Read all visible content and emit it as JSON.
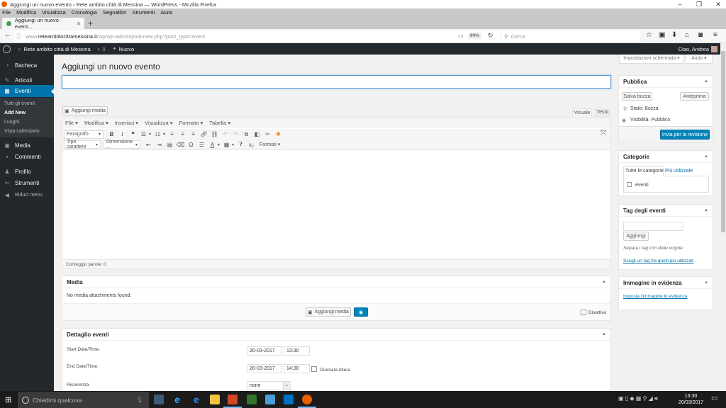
{
  "window": {
    "title": "Aggiungi un nuovo evento ‹ Rete ambito città di Messina — WordPress - Mozilla Firefox",
    "minimize": "–",
    "restore": "❐",
    "close": "✕"
  },
  "menubar": [
    "File",
    "Modifica",
    "Visualizza",
    "Cronologia",
    "Segnalibri",
    "Strumenti",
    "Aiuto"
  ],
  "browser": {
    "tab_title": "Aggiungi un nuovo event...",
    "tab_close": "✕",
    "new_tab": "+",
    "url_domain": "www.reteambitocittamessina.it",
    "url_path": "/wp/wp-admin/post-new.php?post_type=event",
    "url_prefix": "www.",
    "url_host": "reteambitocittamessina.it",
    "zoom_level": "90%",
    "search_placeholder": "Cerca"
  },
  "adminbar": {
    "site_name": "Rete ambito città di Messina",
    "comments_count": "0",
    "new_label": "Nuovo",
    "greeting": "Ciao, Andrea"
  },
  "sidebar": {
    "items": [
      {
        "label": "Bacheca",
        "icon": "dashboard-icon"
      },
      {
        "label": "Articoli",
        "icon": "pin-icon"
      },
      {
        "label": "Eventi",
        "icon": "calendar-icon"
      },
      {
        "label": "Media",
        "icon": "media-icon"
      },
      {
        "label": "Commenti",
        "icon": "comment-icon"
      },
      {
        "label": "Profilo",
        "icon": "user-icon"
      },
      {
        "label": "Strumenti",
        "icon": "wrench-icon"
      },
      {
        "label": "Riduci menu",
        "icon": "collapse-icon"
      }
    ],
    "submenu": [
      "Tutti gli eventi",
      "Add New",
      "Luoghi",
      "Vista calendario"
    ]
  },
  "header": {
    "screen_options": "Impostazioni schermata ▾",
    "help": "Aiuto ▾",
    "page_title": "Aggiungi un nuovo evento",
    "title_value": ""
  },
  "editor": {
    "add_media": "Aggiungi media",
    "tab_visual": "Visuale",
    "tab_text": "Testo",
    "menus": [
      "File ▾",
      "Modifica ▾",
      "Inserisci ▾",
      "Visualizza ▾",
      "Formato ▾",
      "Tabella ▾"
    ],
    "paragraph_select": "Paragrafo",
    "font_family_select": "Tipo carattere",
    "font_size_select": "Dimensione ...",
    "formats_label": "Formati ▾",
    "word_count": "Conteggio parole: 0"
  },
  "media_box": {
    "title": "Media",
    "empty_text": "No media attachments found.",
    "add_media": "Aggiungi media",
    "disable_label": "Disattiva"
  },
  "event_details": {
    "title": "Dettaglio eventi",
    "start_label": "Start Date/Time:",
    "start_date": "20-03-2017",
    "start_time": "13:30",
    "end_label": "End Date/Time:",
    "end_date": "20-03-2017",
    "end_time": "14:30",
    "all_day_label": "Giornata intera",
    "recurrence_label": "Ricorrenza",
    "recurrence_value": "none"
  },
  "publish_box": {
    "title": "Pubblica",
    "save_draft": "Salva bozza",
    "preview": "Anteprima",
    "status": "Stato: Bozza",
    "visibility": "Visibilità: Pubblico",
    "submit": "Invia per la revisione"
  },
  "categories_box": {
    "title": "Categorie",
    "tab_all": "Tutte le categorie",
    "tab_popular": "Più utilizzate",
    "items": [
      "eventi"
    ]
  },
  "tags_box": {
    "title": "Tag degli eventi",
    "add_button": "Aggiungi",
    "hint": "Separa i tag con delle virgole",
    "choose_link": "Scegli un tag fra quelli più utilizzati"
  },
  "featured_box": {
    "title": "Immagine in evidenza",
    "set_link": "Imposta l'immagine in evidenza"
  },
  "taskbar": {
    "search_placeholder": "Chiedimi qualcosa",
    "time": "13:30",
    "date": "20/03/2017"
  },
  "colors": {
    "admin_bar": "#23282d",
    "accent": "#0073aa",
    "primary_button": "#0085ba"
  }
}
